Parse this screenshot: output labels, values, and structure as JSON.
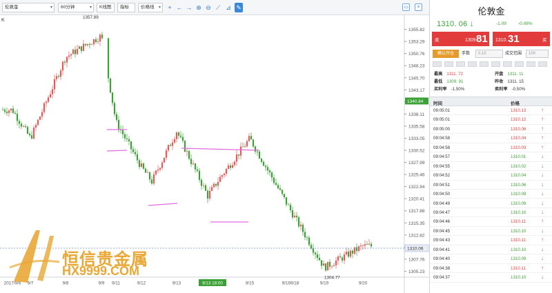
{
  "toolbar": {
    "symbol": "伦敦金",
    "period": "60分钟",
    "chart_type": "K线图",
    "indicator": "指标",
    "price_line": "价格线"
  },
  "chart_data": {
    "type": "candlestick",
    "y_ticks": [
      "1355.82",
      "1353.29",
      "1350.76",
      "1348.23",
      "1345.70",
      "1343.17",
      "1340.64",
      "1338.11",
      "1335.58",
      "1333.05",
      "1330.52",
      "1327.99",
      "1325.46",
      "1322.94",
      "1320.41",
      "1317.88",
      "1315.35",
      "1312.82",
      "1310.29",
      "1307.76",
      "1305.23"
    ],
    "x_ticks": [
      "2017/9/6",
      "9/7",
      "9/8",
      "9/9",
      "9/11",
      "9/12",
      "9/13",
      "9/13 18:00",
      "9/15",
      "9/169/18",
      "9/19",
      "9/20"
    ],
    "ylim": [
      1304.0,
      1358.5
    ],
    "high_label": "1357.89",
    "low_label": "1304.77",
    "current_price_tag": "1310.06",
    "crosshair_price_tag": "1340.84",
    "corner_mark": "K",
    "bull_color": "#e05b5b",
    "bear_color": "#3ba035",
    "trendline_color": "#e26be0",
    "current_line_color": "#6b8fd6",
    "anchors": [
      [
        "2017/9/6",
        1339.0
      ],
      [
        "9/7",
        1333.0
      ],
      [
        "9/8",
        1350.0
      ],
      [
        "9/9",
        1354.5
      ],
      [
        "9/9",
        1347.5
      ],
      [
        "9/11",
        1336.5
      ],
      [
        "9/12",
        1327.0
      ],
      [
        "9/12",
        1324.0
      ],
      [
        "9/13",
        1334.5
      ],
      [
        "9/13",
        1321.0
      ],
      [
        "9/13 18:00",
        1325.0
      ],
      [
        "9/15",
        1333.0
      ],
      [
        "9/169/18",
        1318.0
      ],
      [
        "9/19",
        1306.0
      ],
      [
        "9/20",
        1310.5
      ]
    ],
    "trendlines": [
      {
        "from": [
          "9/11",
          1339.2
        ],
        "to": [
          "9/11",
          1339.2
        ]
      },
      {
        "from": [
          "9/11",
          1334.7
        ],
        "to": [
          "9/11",
          1334.7
        ]
      },
      {
        "from": [
          "9/12",
          1322.6
        ],
        "to": [
          "9/12",
          1323.6
        ]
      },
      {
        "from": [
          "9/13",
          1334.8
        ],
        "to": [
          "9/15",
          1334.3
        ]
      },
      {
        "from": [
          "9/13",
          1319.5
        ],
        "to": [
          "9/13 18:00",
          1319.7
        ]
      }
    ]
  },
  "panel": {
    "title": "伦敦金",
    "price": "1310. 06",
    "arrow": "↓",
    "change": "-1.09",
    "change_pct": "-0.08%",
    "sell": {
      "label": "卖",
      "small": "1309",
      "big": "81"
    },
    "buy": {
      "label": "买",
      "small": "1310.",
      "big": "31"
    },
    "confirm_label": "确认开仓",
    "lots_label": "手数",
    "lots_value": "0.10",
    "range_label": "成交范围",
    "range_value": "100",
    "stats": {
      "high_k": "最高",
      "high_v": "1311. 72",
      "open_k": "开盘",
      "open_v": "1311. 11",
      "low_k": "最低",
      "low_v": "1309. 91",
      "prev_k": "昨收",
      "prev_v": "1311. 15",
      "buyrate_k": "买利率",
      "buyrate_v": "-1.50%",
      "sellrate_k": "卖利率",
      "sellrate_v": "-0.50%"
    },
    "trade_header": {
      "time": "时间",
      "price": "价格"
    },
    "trades": [
      {
        "time": "09:05:01",
        "price": "1310.13",
        "dir": "up"
      },
      {
        "time": "09:05:01",
        "price": "1310.12",
        "dir": "up"
      },
      {
        "time": "09:05:00",
        "price": "1310.06",
        "dir": "up"
      },
      {
        "time": "09:04:58",
        "price": "1310.04",
        "dir": "up"
      },
      {
        "time": "09:04:58",
        "price": "1310.03",
        "dir": "up"
      },
      {
        "time": "09:04:57",
        "price": "1310.01",
        "dir": "down"
      },
      {
        "time": "09:04:55",
        "price": "1310.02",
        "dir": "down"
      },
      {
        "time": "09:04:52",
        "price": "1310.04",
        "dir": "down"
      },
      {
        "time": "09:04:51",
        "price": "1310.06",
        "dir": "down"
      },
      {
        "time": "09:04:50",
        "price": "1310.08",
        "dir": "down"
      },
      {
        "time": "09:04:49",
        "price": "1310.09",
        "dir": "down"
      },
      {
        "time": "09:04:47",
        "price": "1310.10",
        "dir": "down"
      },
      {
        "time": "09:04:46",
        "price": "1310.11",
        "dir": "up"
      },
      {
        "time": "09:04:45",
        "price": "1310.10",
        "dir": "down"
      },
      {
        "time": "09:04:43",
        "price": "1310.11",
        "dir": "up"
      },
      {
        "time": "09:04:41",
        "price": "1310.10",
        "dir": "down"
      },
      {
        "time": "09:04:40",
        "price": "1310.09",
        "dir": "down"
      },
      {
        "time": "09:04:38",
        "price": "1310.11",
        "dir": "up"
      },
      {
        "time": "09:04:37",
        "price": "1310.10",
        "dir": "down"
      }
    ]
  },
  "logo": {
    "cn": "恒信贵金属",
    "url": "HX9999.COM"
  },
  "colors": {
    "up": "#e13b3b",
    "down": "#3ba035",
    "accent": "#2b7bd6"
  }
}
